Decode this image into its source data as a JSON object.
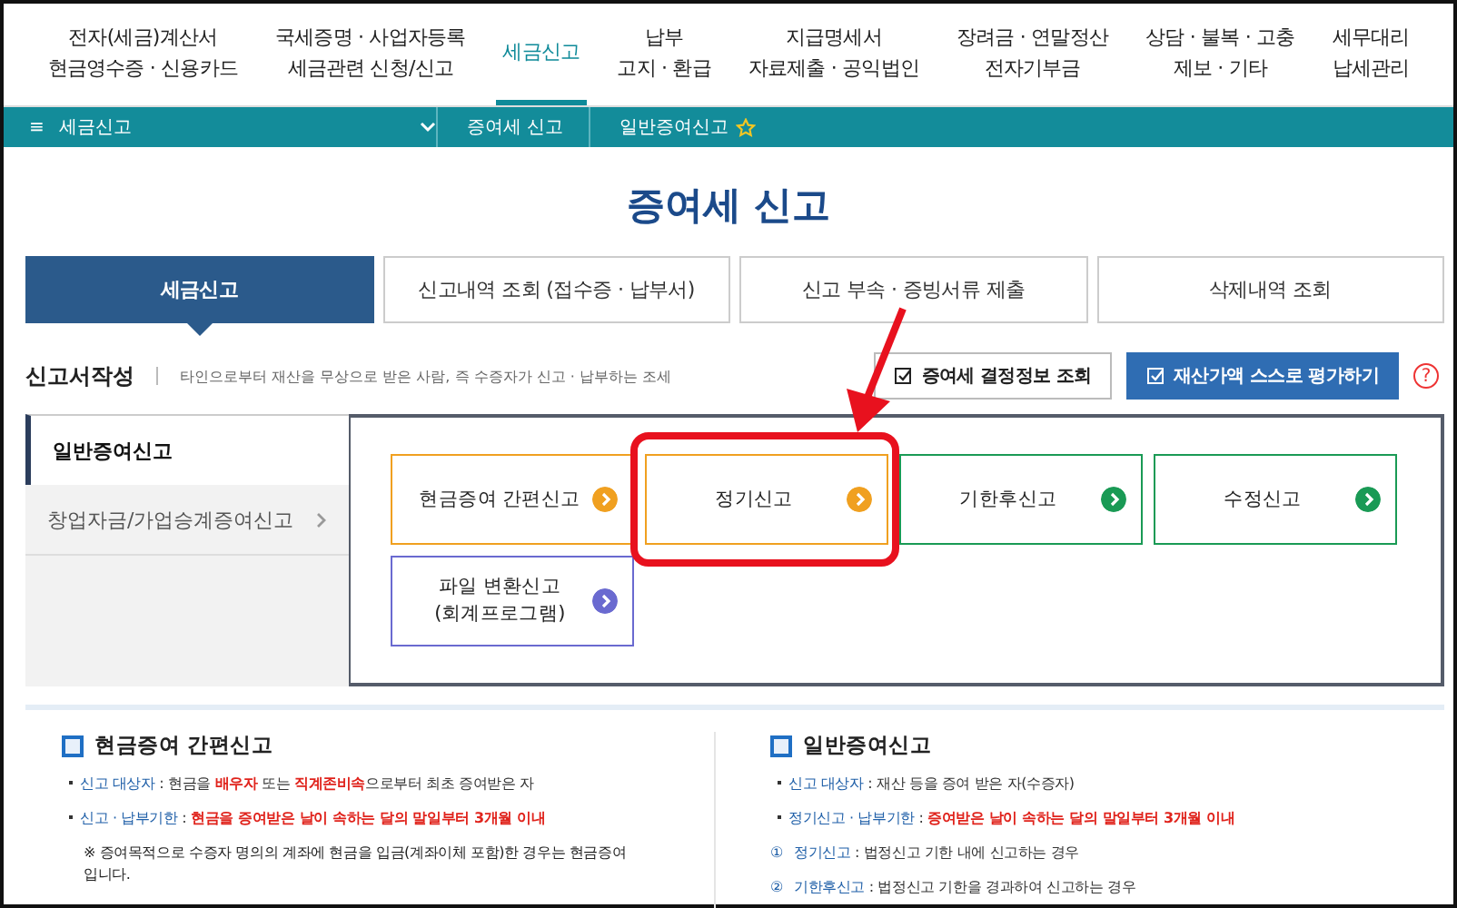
{
  "top_nav": [
    {
      "lines": [
        "전자(세금)계산서",
        "현금영수증 · 신용카드"
      ],
      "selected": false
    },
    {
      "lines": [
        "국세증명 · 사업자등록",
        "세금관련 신청/신고"
      ],
      "selected": false
    },
    {
      "lines": [
        "세금신고"
      ],
      "selected": true
    },
    {
      "lines": [
        "납부",
        "고지 · 환급"
      ],
      "selected": false
    },
    {
      "lines": [
        "지급명세서",
        "자료제출 · 공익법인"
      ],
      "selected": false
    },
    {
      "lines": [
        "장려금 · 연말정산",
        "전자기부금"
      ],
      "selected": false
    },
    {
      "lines": [
        "상담 · 불복 · 고충",
        "제보 · 기타"
      ],
      "selected": false
    },
    {
      "lines": [
        "세무대리",
        "납세관리"
      ],
      "selected": false
    }
  ],
  "breadcrumb": {
    "menu_icon": "≡",
    "items": [
      "세금신고",
      "증여세 신고",
      "일반증여신고"
    ],
    "favorite": false
  },
  "page_title": "증여세 신고",
  "tabs": [
    {
      "label": "세금신고",
      "selected": true
    },
    {
      "label": "신고내역 조회 (접수증 · 납부서)",
      "selected": false
    },
    {
      "label": "신고 부속 · 증빙서류 제출",
      "selected": false
    },
    {
      "label": "삭제내역 조회",
      "selected": false
    }
  ],
  "section": {
    "title": "신고서작성",
    "description": "타인으로부터 재산을 무상으로 받은 사람, 즉 수증자가 신고 · 납부하는 조세",
    "buttons": [
      {
        "label": "증여세 결정정보 조회",
        "primary": false
      },
      {
        "label": "재산가액 스스로 평가하기",
        "primary": true
      }
    ],
    "help": "?"
  },
  "side_menu": [
    {
      "label": "일반증여신고",
      "selected": true
    },
    {
      "label": "창업자금/가업승계증여신고",
      "selected": false
    }
  ],
  "cards": [
    {
      "lines": [
        "현금증여 간편신고"
      ],
      "color": "#f0a020",
      "highlighted": false
    },
    {
      "lines": [
        "정기신고"
      ],
      "color": "#f0a020",
      "highlighted": true
    },
    {
      "lines": [
        "기한후신고"
      ],
      "color": "#1a9a55",
      "highlighted": false
    },
    {
      "lines": [
        "수정신고"
      ],
      "color": "#1a9a55",
      "highlighted": false
    },
    {
      "lines": [
        "파일 변환신고",
        "(회계프로그램)"
      ],
      "color": "#6a6ad0",
      "highlighted": false
    }
  ],
  "info": [
    {
      "title": "현금증여 간편신고",
      "rows": [
        {
          "kind": "bullet",
          "parts": [
            {
              "text": "신고 대상자",
              "kind": "label"
            },
            {
              "text": " : 현금을 ",
              "kind": "plain"
            },
            {
              "text": "배우자",
              "kind": "alert"
            },
            {
              "text": " 또는 ",
              "kind": "plain"
            },
            {
              "text": "직계존비속",
              "kind": "alert"
            },
            {
              "text": "으로부터 최초 증여받은 자",
              "kind": "plain"
            }
          ]
        },
        {
          "kind": "bullet",
          "parts": [
            {
              "text": "신고 · 납부기한",
              "kind": "label"
            },
            {
              "text": " : ",
              "kind": "plain"
            },
            {
              "text": "현금을 증여받은 날이 속하는 달의 말일부터 3개월 이내",
              "kind": "alert"
            }
          ]
        },
        {
          "kind": "note",
          "text": "※ 증여목적으로 수증자 명의의 계좌에 현금을 입금(계좌이체 포함)한 경우는   현금증여입니다."
        }
      ]
    },
    {
      "title": "일반증여신고",
      "rows": [
        {
          "kind": "bullet",
          "parts": [
            {
              "text": "신고 대상자",
              "kind": "label"
            },
            {
              "text": " : 재산 등을 증여 받은 자(수증자)",
              "kind": "plain"
            }
          ]
        },
        {
          "kind": "bullet",
          "parts": [
            {
              "text": "정기신고 · 납부기한",
              "kind": "label"
            },
            {
              "text": " : ",
              "kind": "plain"
            },
            {
              "text": "증여받은 날이 속하는 달의 말일부터 3개월 이내",
              "kind": "alert"
            }
          ]
        },
        {
          "kind": "numbered",
          "marker": "①",
          "parts": [
            {
              "text": "정기신고",
              "kind": "label"
            },
            {
              "text": " : 법정신고 기한 내에 신고하는 경우",
              "kind": "plain"
            }
          ]
        },
        {
          "kind": "numbered",
          "marker": "②",
          "parts": [
            {
              "text": "기한후신고",
              "kind": "label"
            },
            {
              "text": " : 법정신고 기한을 경과하여 신고하는 경우",
              "kind": "plain"
            }
          ]
        }
      ]
    }
  ]
}
